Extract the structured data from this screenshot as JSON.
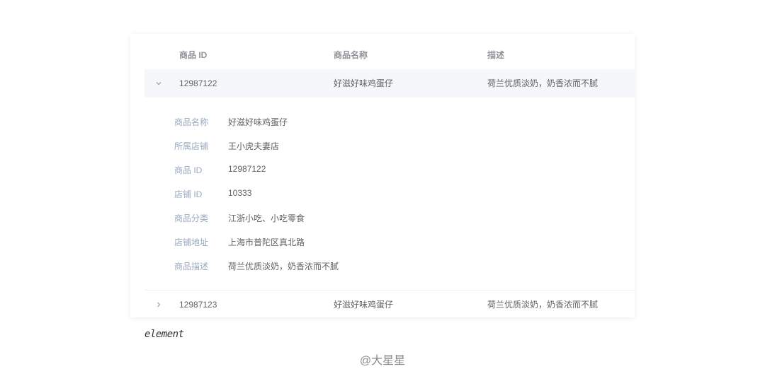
{
  "table": {
    "columns": [
      "商品 ID",
      "商品名称",
      "描述"
    ],
    "rows": [
      {
        "id": "12987122",
        "name": "好滋好味鸡蛋仔",
        "desc": "荷兰优质淡奶，奶香浓而不腻",
        "expanded": true,
        "details": [
          {
            "label": "商品名称",
            "value": "好滋好味鸡蛋仔"
          },
          {
            "label": "所属店铺",
            "value": "王小虎夫妻店"
          },
          {
            "label": "商品 ID",
            "value": "12987122"
          },
          {
            "label": "店铺 ID",
            "value": "10333"
          },
          {
            "label": "商品分类",
            "value": "江浙小吃、小吃零食"
          },
          {
            "label": "店铺地址",
            "value": "上海市普陀区真北路"
          },
          {
            "label": "商品描述",
            "value": "荷兰优质淡奶，奶香浓而不腻"
          }
        ]
      },
      {
        "id": "12987123",
        "name": "好滋好味鸡蛋仔",
        "desc": "荷兰优质淡奶，奶香浓而不腻",
        "expanded": false
      }
    ]
  },
  "caption": "element",
  "watermark": "@大星星",
  "colors": {
    "header_text": "#909399",
    "body_text": "#606266",
    "detail_label": "#99a9bf",
    "hover_row_bg": "#f5f7fa",
    "border": "#ebeef5"
  },
  "icons": {
    "expanded": "chevron-down-icon",
    "collapsed": "chevron-right-icon"
  }
}
